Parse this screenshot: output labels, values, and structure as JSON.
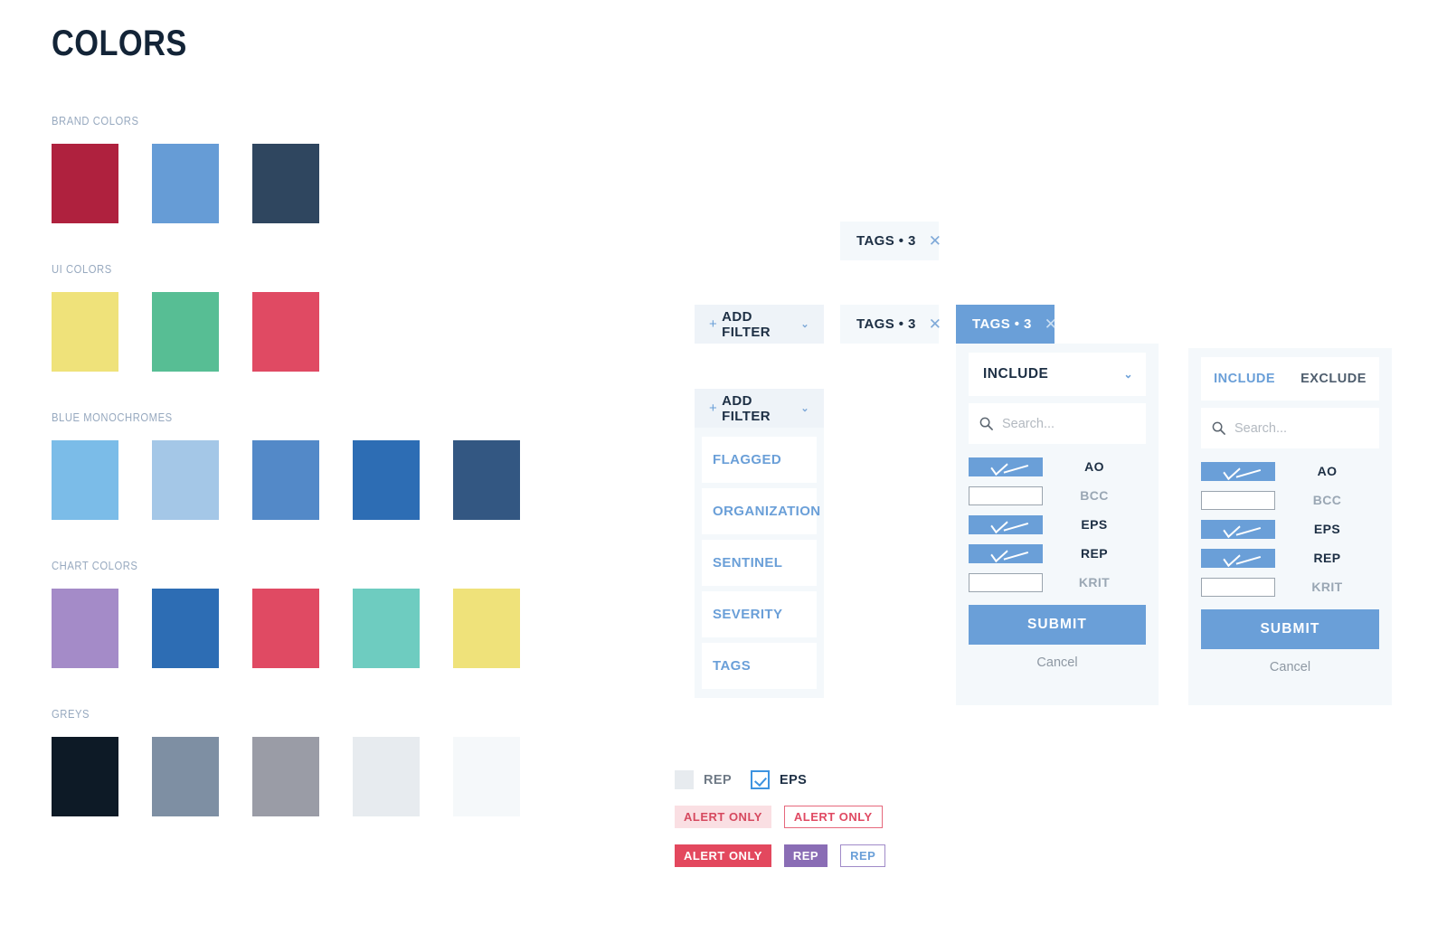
{
  "page": {
    "title": "COLORS"
  },
  "palette": {
    "groups": [
      {
        "label": "BRAND COLORS",
        "swatches": [
          {
            "name": "brand-crimson",
            "hex": "#AF213E"
          },
          {
            "name": "brand-blue",
            "hex": "#669CD6"
          },
          {
            "name": "brand-navy",
            "hex": "#2F465F"
          }
        ]
      },
      {
        "label": "UI COLORS",
        "swatches": [
          {
            "name": "ui-yellow",
            "hex": "#EFE27A"
          },
          {
            "name": "ui-green",
            "hex": "#57BE94"
          },
          {
            "name": "ui-red",
            "hex": "#E04A63"
          }
        ]
      },
      {
        "label": "BLUE MONOCHROMES",
        "swatches": [
          {
            "name": "blue-100",
            "hex": "#7BBCE8"
          },
          {
            "name": "blue-200",
            "hex": "#A4C7E7"
          },
          {
            "name": "blue-300",
            "hex": "#5389C8"
          },
          {
            "name": "blue-400",
            "hex": "#2D6DB4"
          },
          {
            "name": "blue-500",
            "hex": "#335782"
          }
        ]
      },
      {
        "label": "CHART COLORS",
        "swatches": [
          {
            "name": "chart-purple",
            "hex": "#A48BC8"
          },
          {
            "name": "chart-blue",
            "hex": "#2D6DB4"
          },
          {
            "name": "chart-red",
            "hex": "#E04A63"
          },
          {
            "name": "chart-teal",
            "hex": "#6ECCC0"
          },
          {
            "name": "chart-yellow",
            "hex": "#EFE27A"
          }
        ]
      },
      {
        "label": "GREYS",
        "swatches": [
          {
            "name": "grey-900",
            "hex": "#0D1A26"
          },
          {
            "name": "grey-600",
            "hex": "#7E8FA3"
          },
          {
            "name": "grey-500",
            "hex": "#9A9CA6"
          },
          {
            "name": "grey-200",
            "hex": "#E7EBEF"
          },
          {
            "name": "grey-100",
            "hex": "#F5F8FA"
          }
        ]
      }
    ]
  },
  "chips": {
    "tags_label": "TAGS • 3",
    "close_glyph": "✕",
    "add_filter": {
      "plus": "+",
      "label": "ADD FILTER",
      "caret": "⌄"
    }
  },
  "filter_dropdown": {
    "trigger": {
      "plus": "+",
      "label": "ADD FILTER",
      "caret": "⌄"
    },
    "items": [
      {
        "label": "FLAGGED"
      },
      {
        "label": "ORGANIZATION"
      },
      {
        "label": "SENTINEL"
      },
      {
        "label": "SEVERITY"
      },
      {
        "label": "TAGS"
      }
    ]
  },
  "popover_include": {
    "select_value": "INCLUDE",
    "caret": "⌄",
    "search_placeholder": "Search...",
    "options": [
      {
        "label": "AO",
        "checked": true
      },
      {
        "label": "BCC",
        "checked": false
      },
      {
        "label": "EPS",
        "checked": true
      },
      {
        "label": "REP",
        "checked": true
      },
      {
        "label": "KRIT",
        "checked": false
      }
    ],
    "submit_label": "SUBMIT",
    "cancel_label": "Cancel"
  },
  "popover_tabs": {
    "tab_include": "INCLUDE",
    "tab_exclude": "EXCLUDE",
    "search_placeholder": "Search...",
    "options": [
      {
        "label": "AO",
        "checked": true
      },
      {
        "label": "BCC",
        "checked": false
      },
      {
        "label": "EPS",
        "checked": true
      },
      {
        "label": "REP",
        "checked": true
      },
      {
        "label": "KRIT",
        "checked": false
      }
    ],
    "submit_label": "SUBMIT",
    "cancel_label": "Cancel"
  },
  "specimens": {
    "checkboxes": [
      {
        "label": "REP",
        "checked": false
      },
      {
        "label": "EPS",
        "checked": true
      }
    ],
    "badges_row_1": [
      {
        "label": "ALERT ONLY",
        "style": "soft-red"
      },
      {
        "label": "ALERT ONLY",
        "style": "out-red"
      }
    ],
    "badges_row_2": [
      {
        "label": "ALERT ONLY",
        "style": "solid-red"
      },
      {
        "label": "REP",
        "style": "solid-purple"
      },
      {
        "label": "REP",
        "style": "out-purple"
      }
    ]
  }
}
